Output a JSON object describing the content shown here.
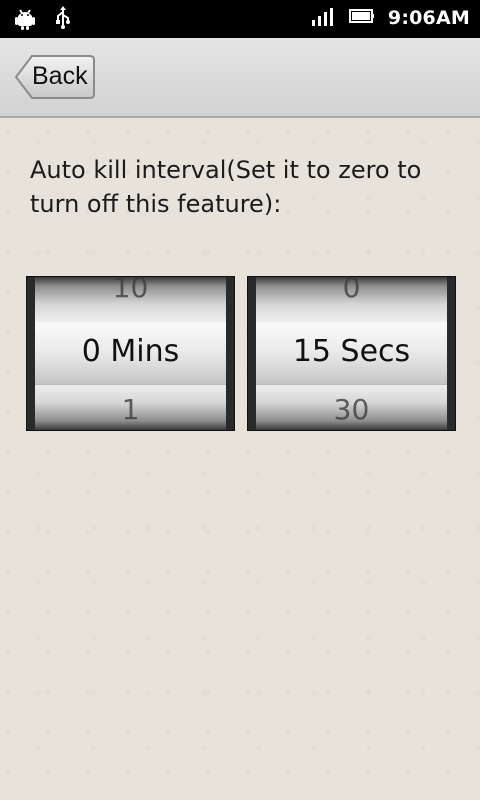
{
  "status_bar": {
    "time": "9:06AM",
    "icons": {
      "left": [
        "android-icon",
        "usb-icon"
      ],
      "right": [
        "signal-icon",
        "battery-icon"
      ]
    }
  },
  "header": {
    "back_label": "Back"
  },
  "instruction": {
    "text": "Auto kill interval(Set it to zero to turn off this feature):"
  },
  "pickers": {
    "minutes": {
      "above": "10",
      "selected": "0 Mins",
      "below": "1"
    },
    "seconds": {
      "above": "0",
      "selected": "15 Secs",
      "below": "30"
    }
  }
}
